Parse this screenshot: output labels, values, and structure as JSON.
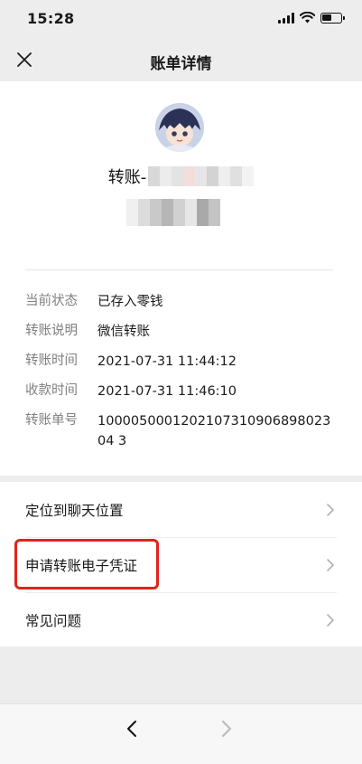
{
  "status_bar": {
    "time": "15:28"
  },
  "nav": {
    "title": "账单详情",
    "close_icon": "close-icon"
  },
  "payee": {
    "label_prefix": "转账-"
  },
  "details": [
    {
      "label": "当前状态",
      "value": "已存入零钱"
    },
    {
      "label": "转账说明",
      "value": "微信转账"
    },
    {
      "label": "转账时间",
      "value": "2021-07-31 11:44:12"
    },
    {
      "label": "收款时间",
      "value": "2021-07-31 11:46:10"
    },
    {
      "label": "转账单号",
      "value": "100005000120210731090689802304 3"
    }
  ],
  "menu": [
    {
      "label": "定位到聊天位置",
      "icon": "chevron-right-icon"
    },
    {
      "label": "申请转账电子凭证",
      "icon": "chevron-right-icon"
    },
    {
      "label": "常见问题",
      "icon": "chevron-right-icon"
    }
  ],
  "colors": {
    "highlight": "#e3221b",
    "background": "#ededed"
  },
  "bottom_bar": {
    "back_icon": "back-arrow-icon",
    "forward_icon": "forward-arrow-icon"
  }
}
